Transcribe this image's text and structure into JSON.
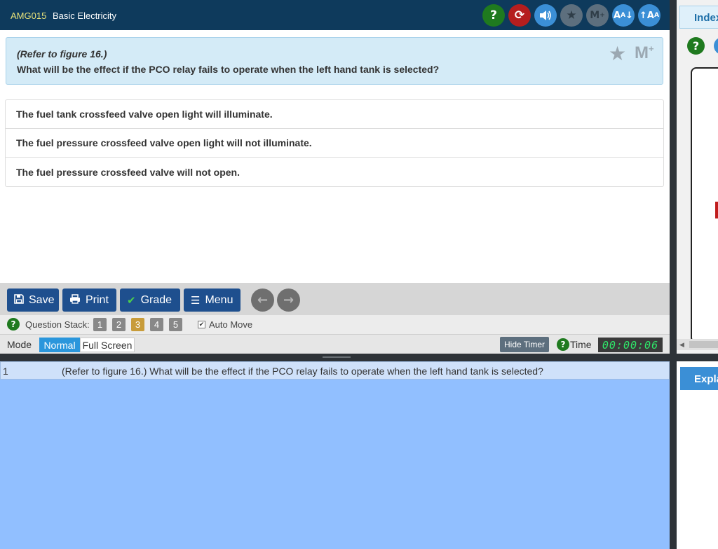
{
  "header": {
    "course_code": "AMG015",
    "subject": "Basic Electricity",
    "icons": {
      "help": "?",
      "reset": "⟳",
      "sound": "🔊",
      "star": "★",
      "mark": "M+",
      "font_down": "AA↓",
      "font_up": "AA↑"
    }
  },
  "question": {
    "reference": "(Refer to figure 16.)",
    "text": "What will be the effect if the PCO relay fails to operate when the left hand tank is selected?",
    "mark_label": "M"
  },
  "answers": [
    "The fuel tank crossfeed valve open light will illuminate.",
    "The fuel pressure crossfeed valve open light will not illuminate.",
    "The fuel pressure crossfeed valve will not open."
  ],
  "toolbar": {
    "save_label": "Save",
    "print_label": "Print",
    "grade_label": "Grade",
    "menu_label": "Menu"
  },
  "stack": {
    "label": "Question Stack:",
    "numbers": [
      "1",
      "2",
      "3",
      "4",
      "5"
    ],
    "active": "3",
    "auto_move_label": "Auto Move",
    "auto_move_checked": true
  },
  "mode": {
    "label": "Mode",
    "normal_label": "Normal",
    "fullscreen_label": "Full Screen",
    "hide_timer_label": "Hide Timer",
    "time_label": "Time",
    "timer_value": "00:00:06"
  },
  "question_list": [
    {
      "number": "1",
      "text": "(Refer to figure 16.) What will be the effect if the PCO relay fails to operate when the left hand tank is selected?"
    }
  ],
  "right_panel": {
    "index_tab_label": "Index",
    "explanation_tab_label": "Expla"
  },
  "colors": {
    "header_bg": "#0e3a5c",
    "accent_blue": "#1e4f8e",
    "question_bg": "#d4ebf7",
    "list_bg": "#91bfff",
    "timer_green": "#2ee86a"
  }
}
